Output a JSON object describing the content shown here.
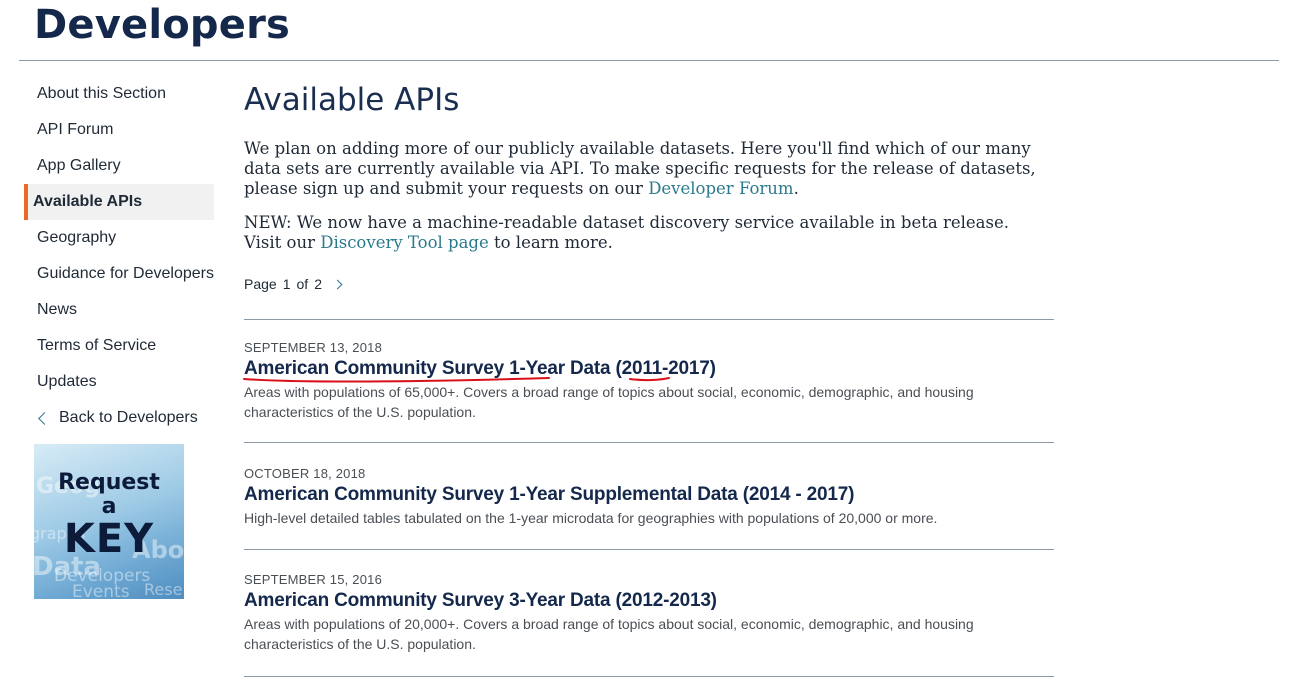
{
  "header": {
    "title": "Developers"
  },
  "sidebar": {
    "items": [
      {
        "label": "About this Section"
      },
      {
        "label": "API Forum"
      },
      {
        "label": "App Gallery"
      },
      {
        "label": "Available APIs",
        "active": true
      },
      {
        "label": "Geography"
      },
      {
        "label": "Guidance for Developers"
      },
      {
        "label": "News"
      },
      {
        "label": "Terms of Service"
      },
      {
        "label": "Updates"
      }
    ],
    "back_label": "Back to Developers",
    "key_banner": {
      "line1": "Request",
      "line2": "a",
      "line3": "KEY",
      "bg_words": [
        "Geog",
        "Data",
        "Abo",
        "Developers",
        "Events",
        "Rese",
        "graphs"
      ]
    }
  },
  "main": {
    "heading": "Available APIs",
    "intro": {
      "text_before": "We plan on adding more of our publicly available datasets. Here you'll find which of our many data sets are currently available via API. To make specific requests for the release of datasets, please sign up and submit your requests on our ",
      "link": "Developer Forum",
      "text_after": "."
    },
    "intro2": {
      "text_before": "NEW: We now have a machine-readable dataset discovery service available in beta release. Visit our ",
      "link": "Discovery Tool page",
      "text_after": " to learn more."
    },
    "pager": {
      "label": "Page",
      "current": "1",
      "of": "of",
      "total": "2"
    },
    "entries": [
      {
        "date": "SEPTEMBER 13, 2018",
        "title": "American Community Survey 1-Year Data (2011-2017)",
        "desc": "Areas with populations of 65,000+. Covers a broad range of topics about social, economic, demographic, and housing characteristics of the U.S. population."
      },
      {
        "date": "OCTOBER 18, 2018",
        "title": "American Community Survey 1-Year Supplemental Data (2014 - 2017)",
        "desc": "High-level detailed tables tabulated on the 1-year microdata for geographies with populations of 20,000 or more."
      },
      {
        "date": "SEPTEMBER 15, 2016",
        "title": "American Community Survey 3-Year Data (2012-2013)",
        "desc": "Areas with populations of 20,000+. Covers a broad range of topics about social, economic, demographic, and housing characteristics of the U.S. population."
      }
    ]
  },
  "colors": {
    "brand_navy": "#14284b",
    "active_accent": "#e86a2a",
    "link_teal": "#2b7a8c",
    "annotation_red": "#d9111a"
  }
}
